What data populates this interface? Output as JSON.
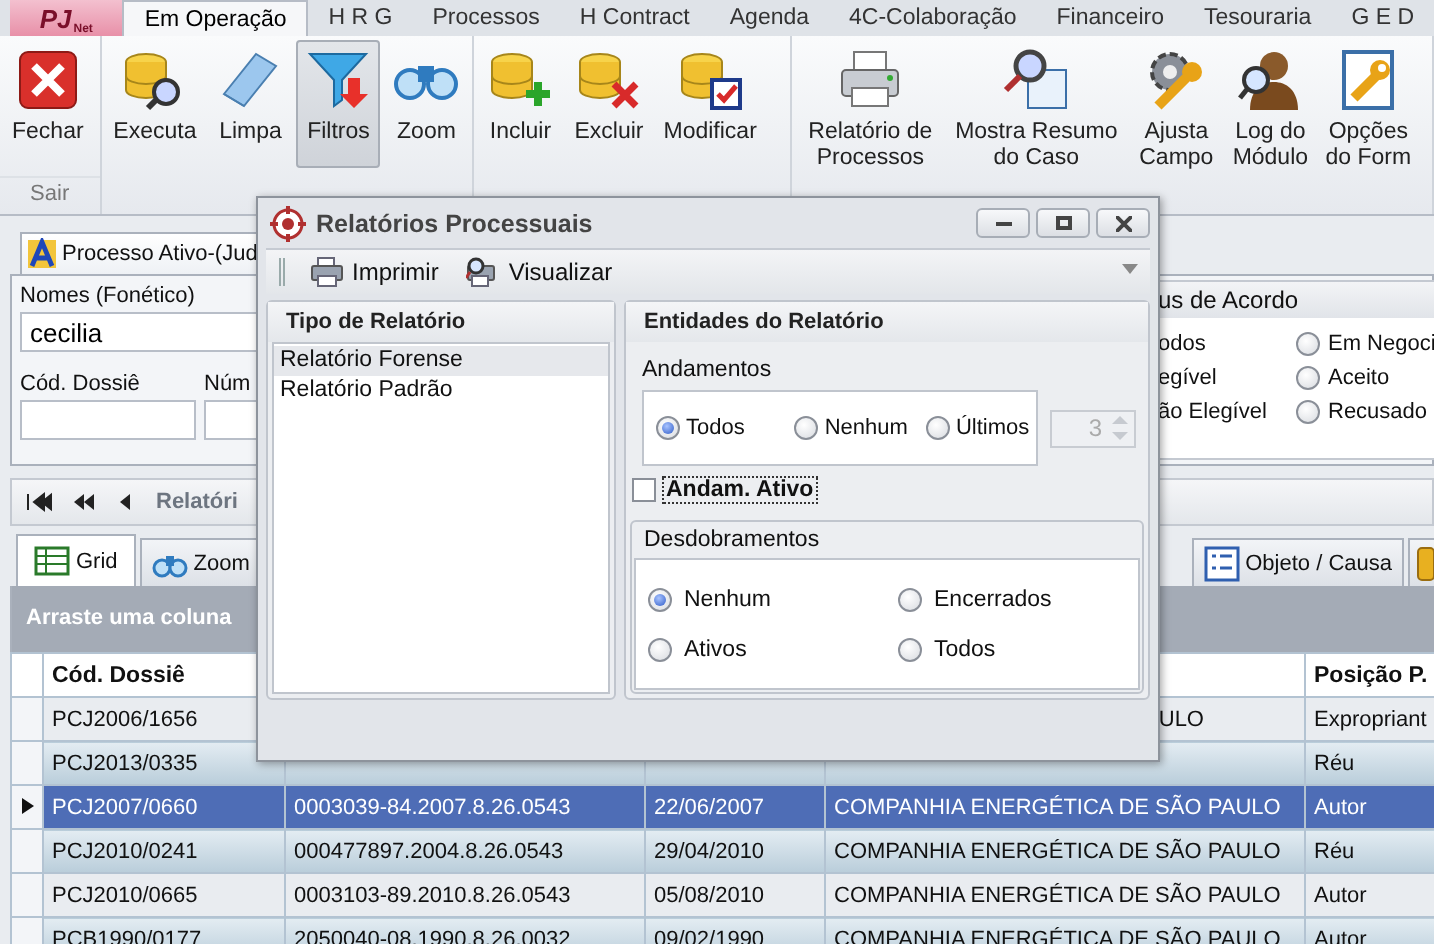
{
  "logo": {
    "text": "PJ",
    "subtext": "Net"
  },
  "ribbon": {
    "tabs": [
      {
        "label": "Em Operação",
        "selected": true
      },
      {
        "label": "H R G",
        "selected": false
      },
      {
        "label": "Processos",
        "selected": false
      },
      {
        "label": "H Contract",
        "selected": false
      },
      {
        "label": "Agenda",
        "selected": false
      },
      {
        "label": "4C-Colaboração",
        "selected": false
      },
      {
        "label": "Financeiro",
        "selected": false
      },
      {
        "label": "Tesouraria",
        "selected": false
      },
      {
        "label": "G E D",
        "selected": false
      }
    ],
    "groups": [
      {
        "label": "Sair",
        "buttons": [
          {
            "label": "Fechar",
            "pressed": false
          }
        ]
      },
      {
        "buttons": [
          {
            "label": "Executa",
            "pressed": false
          },
          {
            "label": "Limpa",
            "pressed": false
          },
          {
            "label": "Filtros",
            "pressed": true
          },
          {
            "label": "Zoom",
            "pressed": false
          }
        ]
      },
      {
        "buttons": [
          {
            "label": "Incluir",
            "pressed": false
          },
          {
            "label": "Excluir",
            "pressed": false
          },
          {
            "label": "Modificar",
            "pressed": false
          }
        ]
      },
      {
        "buttons": [
          {
            "label": "Relatório de Processos",
            "pressed": false
          },
          {
            "label": "Mostra Resumo do Caso",
            "pressed": false
          },
          {
            "label": "Ajusta Campo",
            "pressed": false
          },
          {
            "label": "Log do Módulo",
            "pressed": false
          },
          {
            "label": "Opções do Form",
            "pressed": false
          }
        ]
      }
    ]
  },
  "document_tab": "Processo Ativo-(Jud",
  "search_form": {
    "names_label": "Nomes (Fonético)",
    "names_value": "cecilia",
    "dossier_label": "Cód. Dossiê",
    "number_label": "Núm",
    "status_title": "us de Acordo",
    "status_left": [
      "odos",
      "egível",
      "ão Elegível"
    ],
    "status_options": [
      {
        "label": "Em Negoci",
        "selected": false
      },
      {
        "label": "Aceito",
        "selected": false
      },
      {
        "label": "Recusado",
        "selected": false
      }
    ]
  },
  "navigator": {
    "title": "Relatóri"
  },
  "view_tabs": [
    {
      "label": "Grid",
      "selected": true
    },
    {
      "label": "Zoom",
      "selected": false
    },
    {
      "label": "Objeto / Causa",
      "selected": false
    }
  ],
  "group_panel": "Arraste uma coluna",
  "table": {
    "columns": [
      "Cód. Dossiê",
      "",
      "",
      "",
      "Posição P."
    ],
    "rows": [
      {
        "cells": [
          "PCJ2006/1656",
          "",
          "",
          "ULO",
          "Expropriant"
        ],
        "selected": false
      },
      {
        "cells": [
          "PCJ2013/0335",
          "",
          "",
          "",
          "Réu"
        ],
        "selected": false
      },
      {
        "cells": [
          "PCJ2007/0660",
          "0003039-84.2007.8.26.0543",
          "22/06/2007",
          "COMPANHIA ENERGÉTICA DE SÃO PAULO",
          "Autor"
        ],
        "selected": true
      },
      {
        "cells": [
          "PCJ2010/0241",
          "000477897.2004.8.26.0543",
          "29/04/2010",
          "COMPANHIA ENERGÉTICA DE SÃO PAULO",
          "Réu"
        ],
        "selected": false
      },
      {
        "cells": [
          "PCJ2010/0665",
          "0003103-89.2010.8.26.0543",
          "05/08/2010",
          "COMPANHIA ENERGÉTICA DE SÃO PAULO",
          "Autor"
        ],
        "selected": false
      },
      {
        "cells": [
          "PCB1990/0177",
          "2050040-08.1990.8.26.0032",
          "09/02/1990",
          "COMPANHIA ENERGÉTICA DE SÃO PAULO",
          "Autor"
        ],
        "selected": false
      }
    ]
  },
  "dialog": {
    "title": "Relatórios Processuais",
    "toolbar": [
      "Imprimir",
      "Visualizar"
    ],
    "report_types_title": "Tipo de Relatório",
    "report_types": [
      {
        "label": "Relatório Forense",
        "selected": true
      },
      {
        "label": "Relatório Padrão",
        "selected": false
      }
    ],
    "entities_title": "Entidades do Relatório",
    "andamentos": {
      "title": "Andamentos",
      "options": [
        {
          "label": "Todos",
          "selected": true
        },
        {
          "label": "Nenhum",
          "selected": false
        },
        {
          "label": "Últimos",
          "selected": false
        }
      ],
      "count": "3",
      "count_disabled": true
    },
    "active_checkbox": {
      "label": "Andam. Ativo",
      "checked": false
    },
    "desdobramentos": {
      "title": "Desdobramentos",
      "options": [
        {
          "label": "Nenhum",
          "selected": true
        },
        {
          "label": "Encerrados",
          "selected": false
        },
        {
          "label": "Ativos",
          "selected": false
        },
        {
          "label": "Todos",
          "selected": false
        }
      ]
    }
  }
}
